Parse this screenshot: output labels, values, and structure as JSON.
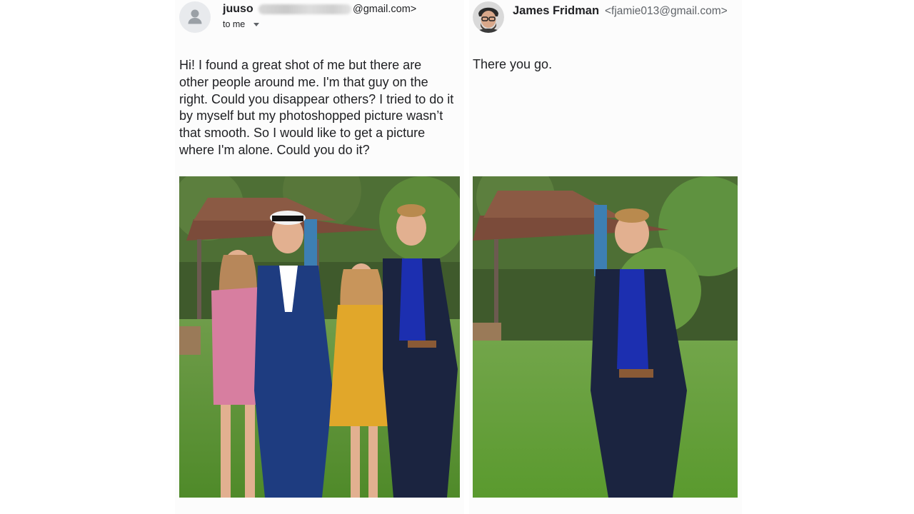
{
  "left_email": {
    "sender_name": "juuso",
    "sender_email_suffix": "@gmail.com>",
    "recipient_label": "to me",
    "body": "Hi! I found a great shot of me but there are other people around me. I'm that guy on the right. Could you disappear others? I tried to do it by myself but my photoshopped picture wasn’t that smooth. So I would like to get a picture where I'm alone. Could you do it?",
    "avatar_icon": "default-person-icon"
  },
  "right_email": {
    "sender_name": "James Fridman",
    "sender_email": "<fjamie013@gmail.com>",
    "body": "There you go.",
    "avatar_icon": "profile-photo"
  },
  "colors": {
    "text_primary": "#202124",
    "text_secondary": "#5f6368",
    "grass": "#5a9a2e",
    "suit_navy": "#1b2440",
    "shirt_blue": "#1c2fb0"
  }
}
